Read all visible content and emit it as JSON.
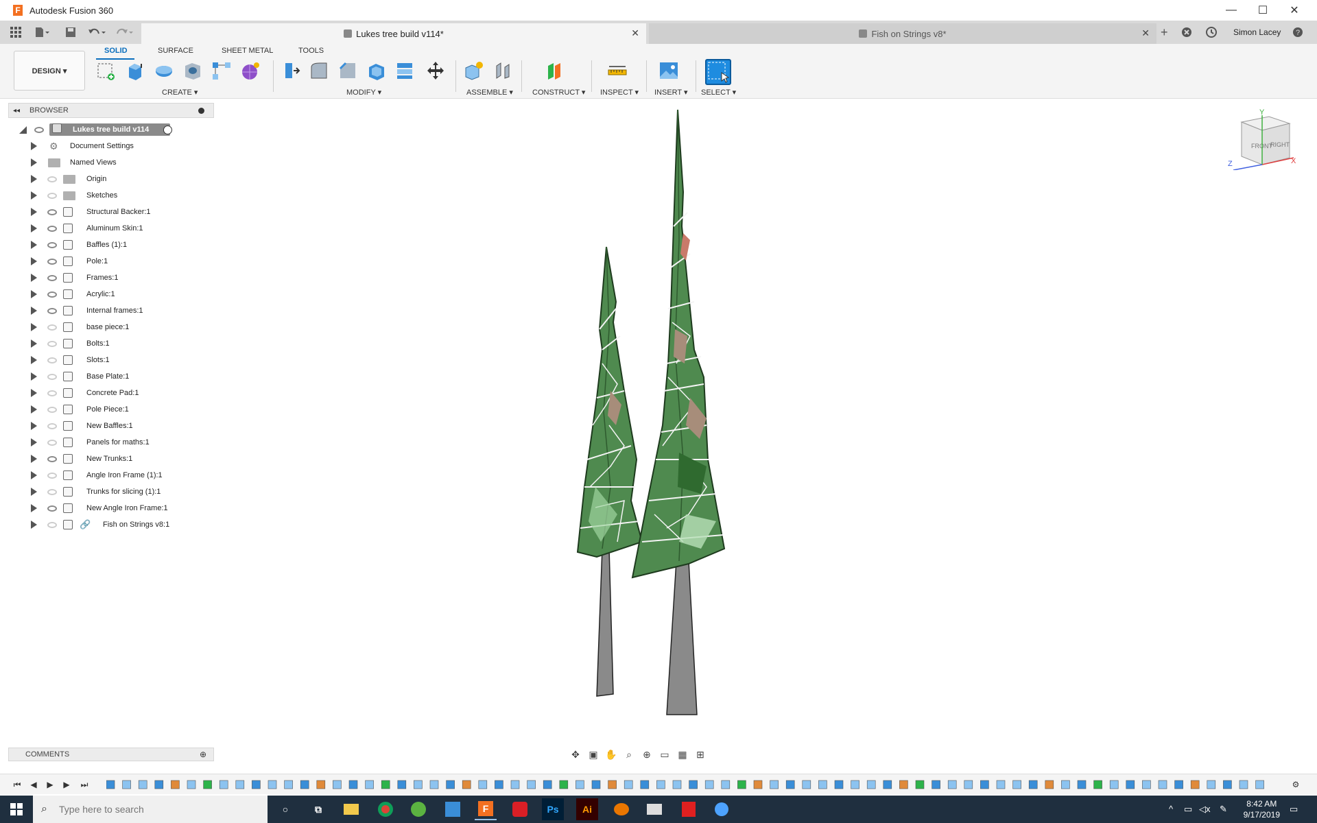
{
  "titlebar": {
    "title": "Autodesk Fusion 360",
    "logo_letter": "F",
    "minimize": "—",
    "maximize": "☐",
    "close": "✕"
  },
  "tabs": {
    "active": {
      "label": "Lukes tree build v114*",
      "close": "✕"
    },
    "inactive": {
      "label": "Fish on Strings v8*",
      "close": "✕"
    },
    "user": "Simon Lacey"
  },
  "toolbar": {
    "design_label": "DESIGN ▾",
    "workspace_tabs": [
      "SOLID",
      "SURFACE",
      "SHEET METAL",
      "TOOLS"
    ],
    "groups": {
      "create": "CREATE ▾",
      "modify": "MODIFY ▾",
      "assemble": "ASSEMBLE ▾",
      "construct": "CONSTRUCT ▾",
      "inspect": "INSPECT ▾",
      "insert": "INSERT ▾",
      "select": "SELECT ▾"
    }
  },
  "browser": {
    "header": "BROWSER",
    "collapse_icon": "◂◂",
    "root": "Lukes tree build v114",
    "items": [
      "Document Settings",
      "Named Views",
      "Origin",
      "Sketches",
      "Structural Backer:1",
      "Aluminum Skin:1",
      "Baffles (1):1",
      "Pole:1",
      "Frames:1",
      "Acrylic:1",
      "Internal frames:1",
      "base piece:1",
      "Bolts:1",
      "Slots:1",
      "Base Plate:1",
      "Concrete Pad:1",
      "Pole Piece:1",
      "New Baffles:1",
      "Panels for maths:1",
      "New Trunks:1",
      "Angle Iron Frame (1):1",
      "Trunks for slicing (1):1",
      "New Angle Iron Frame:1",
      "Fish on Strings v8:1"
    ]
  },
  "comments": {
    "label": "COMMENTS"
  },
  "viewcube": {
    "front": "FRONT",
    "right": "RIGHT",
    "x": "X",
    "y": "Y",
    "z": "Z"
  },
  "taskbar": {
    "search_placeholder": "Type here to search",
    "time": "8:42 AM",
    "date": "9/17/2019",
    "apps": {
      "ps": "Ps",
      "ai": "Ai"
    }
  },
  "colors": {
    "accent": "#0a6ebd",
    "tree_green": "#5e9b5e",
    "trunk_gray": "#8a8a8a",
    "taskbar": "#1f2f3f"
  }
}
